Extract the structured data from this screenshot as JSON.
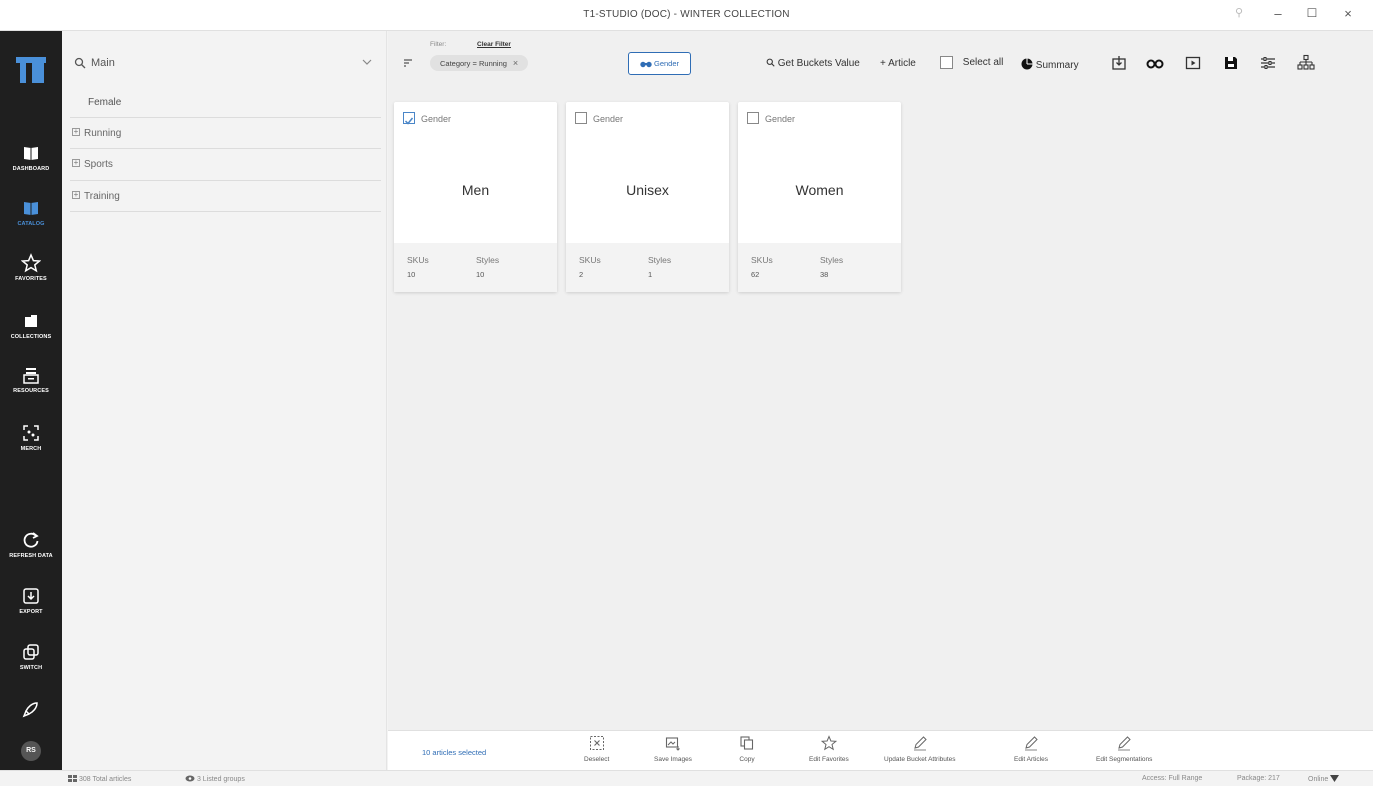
{
  "window": {
    "title": "T1-STUDIO (DOC) - WINTER COLLECTION"
  },
  "nav": {
    "items": [
      {
        "label": "DASHBOARD"
      },
      {
        "label": "CATALOG"
      },
      {
        "label": "FAVORITES"
      },
      {
        "label": "COLLECTIONS"
      },
      {
        "label": "RESOURCES"
      },
      {
        "label": "MERCH"
      },
      {
        "label": "REFRESH DATA"
      },
      {
        "label": "EXPORT"
      },
      {
        "label": "SWITCH"
      }
    ],
    "avatar": "RS",
    "active_color": "#4a90d9"
  },
  "tree": {
    "search_value": "Main",
    "root": "Female",
    "items": [
      {
        "label": "Running"
      },
      {
        "label": "Sports"
      },
      {
        "label": "Training"
      }
    ]
  },
  "toolbar": {
    "filter_label": "Filter:",
    "clear_filter": "Clear Filter",
    "chip": "Category = Running",
    "gender_button": "Gender",
    "get_buckets": "Get Buckets Value",
    "add_article": "+ Article",
    "select_all": "Select all",
    "summary": "Summary",
    "accent_color": "#2f6db5"
  },
  "cards": [
    {
      "checkbox_label": "Gender",
      "checked": true,
      "value": "Men",
      "skus_label": "SKUs",
      "styles_label": "Styles",
      "skus": "10",
      "styles": "10"
    },
    {
      "checkbox_label": "Gender",
      "checked": false,
      "value": "Unisex",
      "skus_label": "SKUs",
      "styles_label": "Styles",
      "skus": "2",
      "styles": "1"
    },
    {
      "checkbox_label": "Gender",
      "checked": false,
      "value": "Women",
      "skus_label": "SKUs",
      "styles_label": "Styles",
      "skus": "62",
      "styles": "38"
    }
  ],
  "actions": {
    "selected": "10 articles selected",
    "items": [
      {
        "label": "Deselect"
      },
      {
        "label": "Save Images"
      },
      {
        "label": "Copy"
      },
      {
        "label": "Edit Favorites"
      },
      {
        "label": "Update Bucket Attributes"
      },
      {
        "label": "Edit Articles"
      },
      {
        "label": "Edit Segmentations"
      }
    ]
  },
  "status": {
    "total_articles": "308 Total articles",
    "listed_groups": "3 Listed groups",
    "access": "Access: Full Range",
    "package": "Package: 217",
    "online": "Online"
  }
}
